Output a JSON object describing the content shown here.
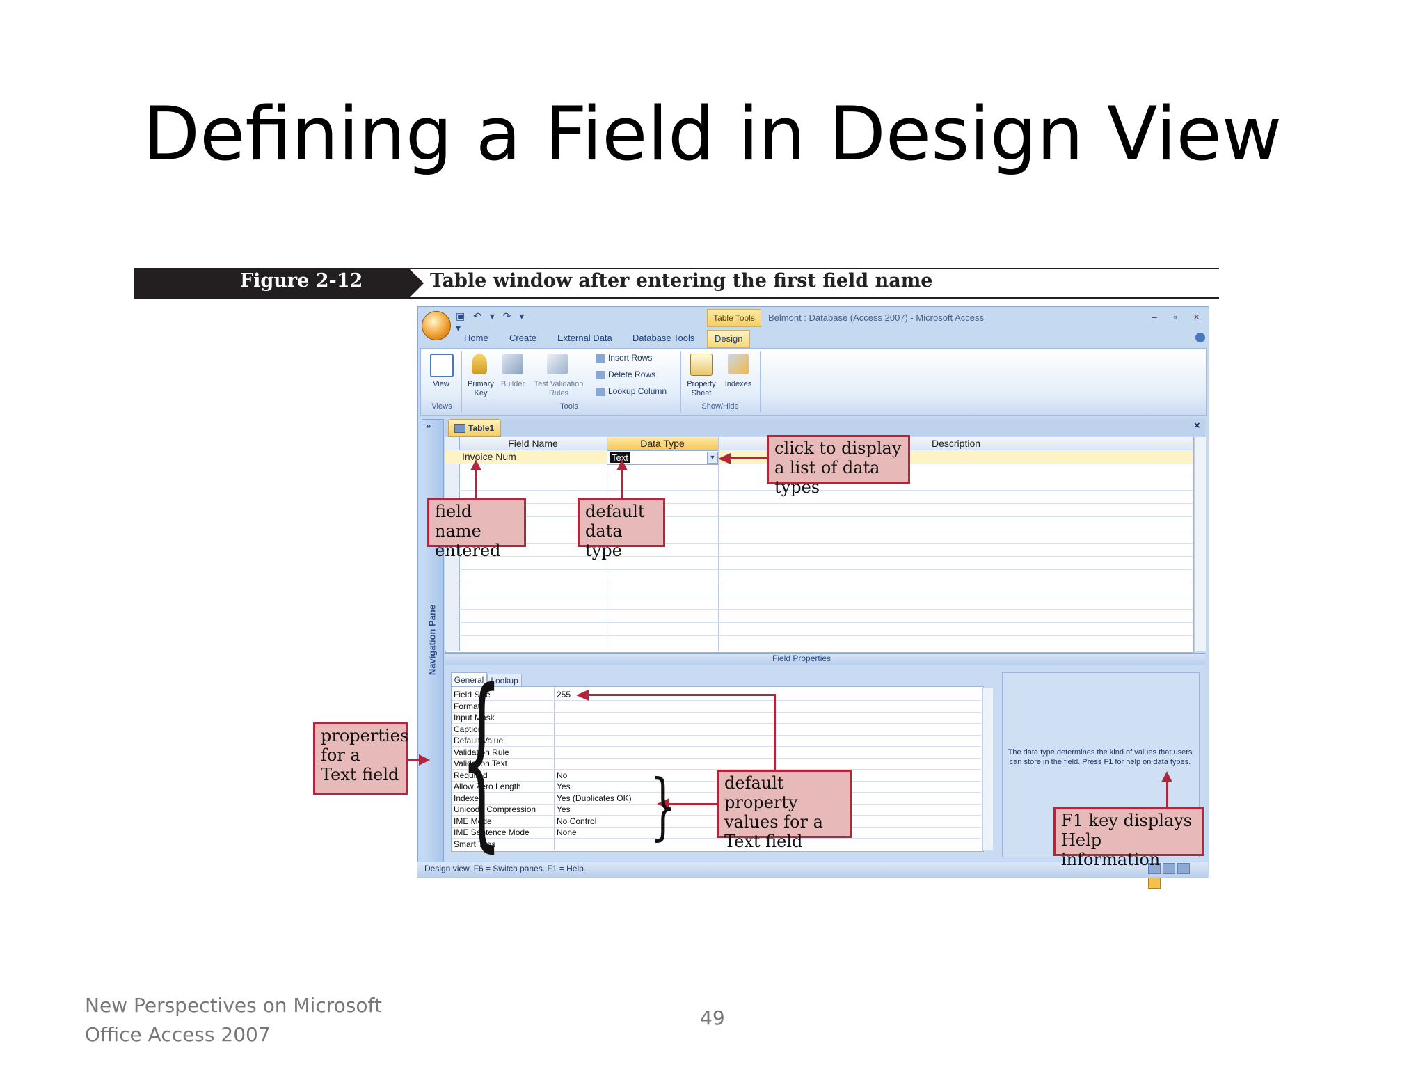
{
  "slide": {
    "title": "Defining a Field in Design View",
    "footer": [
      "New Perspectives on Microsoft",
      "Office Access 2007"
    ],
    "page_number": "49"
  },
  "figure": {
    "label": "Figure 2-12",
    "caption": "Table window after entering the first field name"
  },
  "window": {
    "title": "Belmont : Database (Access 2007) - Microsoft Access",
    "context_tab": "Table Tools",
    "controls": "– ▫ ×"
  },
  "ribbon": {
    "tabs": [
      "Home",
      "Create",
      "External Data",
      "Database Tools",
      "Design"
    ],
    "active_tab": "Design",
    "groups": {
      "views": {
        "label": "Views",
        "buttons": [
          {
            "label": "View",
            "icon": "view-icon"
          }
        ]
      },
      "tools": {
        "label": "Tools",
        "buttons": [
          {
            "label": "Primary Key",
            "icon": "key-icon"
          },
          {
            "label": "Builder",
            "icon": "builder-icon"
          },
          {
            "label": "Test Validation Rules",
            "icon": "test-validation-icon"
          }
        ],
        "small_buttons": [
          "Insert Rows",
          "Delete Rows",
          "Lookup Column"
        ]
      },
      "show_hide": {
        "label": "Show/Hide",
        "buttons": [
          {
            "label": "Property Sheet",
            "icon": "property-sheet-icon"
          },
          {
            "label": "Indexes",
            "icon": "indexes-icon"
          }
        ]
      }
    }
  },
  "navigation_pane": {
    "label": "Navigation Pane",
    "toggle": "»"
  },
  "document": {
    "tab": "Table1",
    "close": "×",
    "columns": [
      "Field Name",
      "Data Type",
      "Description"
    ],
    "rows": [
      {
        "field_name": "Invoice Num",
        "data_type": "Text",
        "description": ""
      }
    ]
  },
  "field_properties": {
    "label": "Field Properties",
    "tabs": [
      "General",
      "Lookup"
    ],
    "active_tab": "General",
    "properties": [
      {
        "name": "Field Size",
        "value": "255"
      },
      {
        "name": "Format",
        "value": ""
      },
      {
        "name": "Input Mask",
        "value": ""
      },
      {
        "name": "Caption",
        "value": ""
      },
      {
        "name": "Default Value",
        "value": ""
      },
      {
        "name": "Validation Rule",
        "value": ""
      },
      {
        "name": "Validation Text",
        "value": ""
      },
      {
        "name": "Required",
        "value": "No"
      },
      {
        "name": "Allow Zero Length",
        "value": "Yes"
      },
      {
        "name": "Indexed",
        "value": "Yes (Duplicates OK)"
      },
      {
        "name": "Unicode Compression",
        "value": "Yes"
      },
      {
        "name": "IME Mode",
        "value": "No Control"
      },
      {
        "name": "IME Sentence Mode",
        "value": "None"
      },
      {
        "name": "Smart Tags",
        "value": ""
      }
    ],
    "help_text": "The data type determines the kind of values that users can store in the field. Press F1 for help on data types."
  },
  "status_bar": {
    "text": "Design view.  F6 = Switch panes.  F1 = Help."
  },
  "callouts": {
    "data_types": "click to display a list of data types",
    "field_name": "field name entered",
    "default_type": "default data type",
    "text_props": "properties for a Text field",
    "default_values": "default property values for a Text field",
    "f1": "F1 key displays Help information"
  },
  "colors": {
    "callout_fill": "#e7b9b8",
    "callout_border": "#b1263a",
    "window_blue": "#c5d9f1",
    "active_tab": "#f8d77a"
  }
}
